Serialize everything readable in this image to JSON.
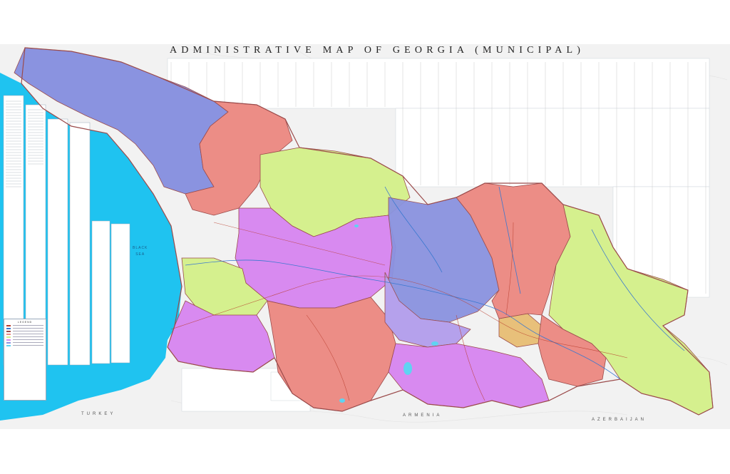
{
  "map": {
    "title": "ADMINISTRATIVE MAP OF GEORGIA (MUNICIPAL)",
    "legend_title": "LEGEND",
    "labels": {
      "turkey": "TURKEY",
      "armenia": "ARMENIA",
      "azerbaijan": "AZERBAIJAN",
      "black_sea": "BLACK\nSEA"
    },
    "colors": {
      "sea": "#1fc3f0",
      "land_outside": "#f2f2f2",
      "region_blue": "#8a93e0",
      "region_salmon": "#ec8d86",
      "region_lime": "#d5f08e",
      "region_magenta": "#d88af0",
      "region_lavender": "#b5a1ec",
      "river": "#3a78d0",
      "road": "#b83c2c",
      "lake": "#5fd3f2",
      "border": "#9b4b4b"
    }
  }
}
